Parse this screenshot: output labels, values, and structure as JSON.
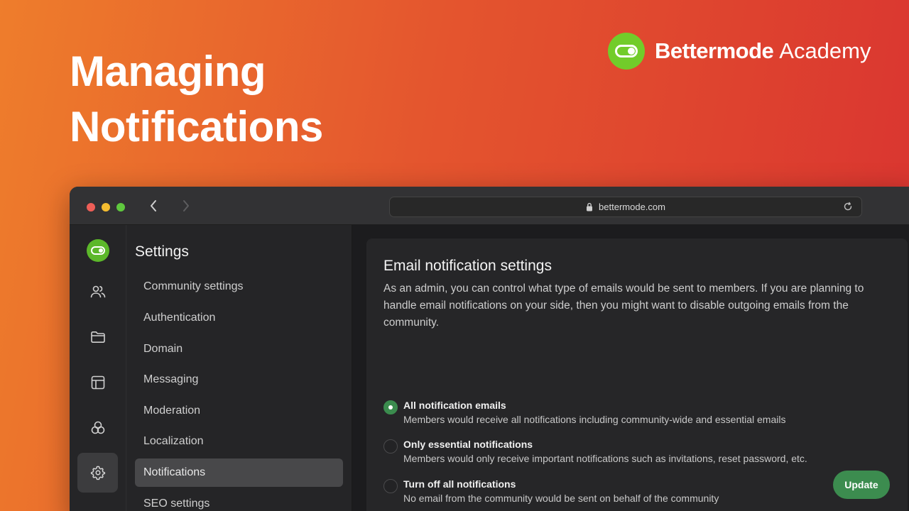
{
  "hero": {
    "line1": "Managing",
    "line2": "Notifications"
  },
  "brand": {
    "name": "Bettermode",
    "sub": "Academy"
  },
  "browser": {
    "url": "bettermode.com"
  },
  "rail": {
    "items": [
      {
        "icon": "community-logo-icon"
      },
      {
        "icon": "members-icon"
      },
      {
        "icon": "folder-icon"
      },
      {
        "icon": "layout-icon"
      },
      {
        "icon": "apps-icon"
      },
      {
        "icon": "gear-icon",
        "active": true
      }
    ]
  },
  "settings": {
    "title": "Settings",
    "items": [
      {
        "label": "Community settings"
      },
      {
        "label": "Authentication"
      },
      {
        "label": "Domain"
      },
      {
        "label": "Messaging"
      },
      {
        "label": "Moderation"
      },
      {
        "label": "Localization"
      },
      {
        "label": "Notifications",
        "active": true
      },
      {
        "label": "SEO settings"
      }
    ]
  },
  "content": {
    "title": "Email notification settings",
    "description": "As an admin, you can control what type of emails would be sent to members. If you are planning to handle email notifications on your side, then you might want to disable outgoing emails from the community.",
    "options": [
      {
        "title": "All notification emails",
        "description": "Members would receive all notifications including community-wide and essential emails",
        "checked": true
      },
      {
        "title": "Only essential notifications",
        "description": "Members would only receive important notifications such as invitations, reset password, etc.",
        "checked": false
      },
      {
        "title": "Turn off all notifications",
        "description": "No email from the community would be sent on behalf of the community",
        "checked": false
      }
    ],
    "update_label": "Update"
  },
  "colors": {
    "accent_green": "#3c8c4f",
    "brand_green": "#72cc2a",
    "gradient_start": "#ee7d2c",
    "gradient_end": "#d93330"
  }
}
